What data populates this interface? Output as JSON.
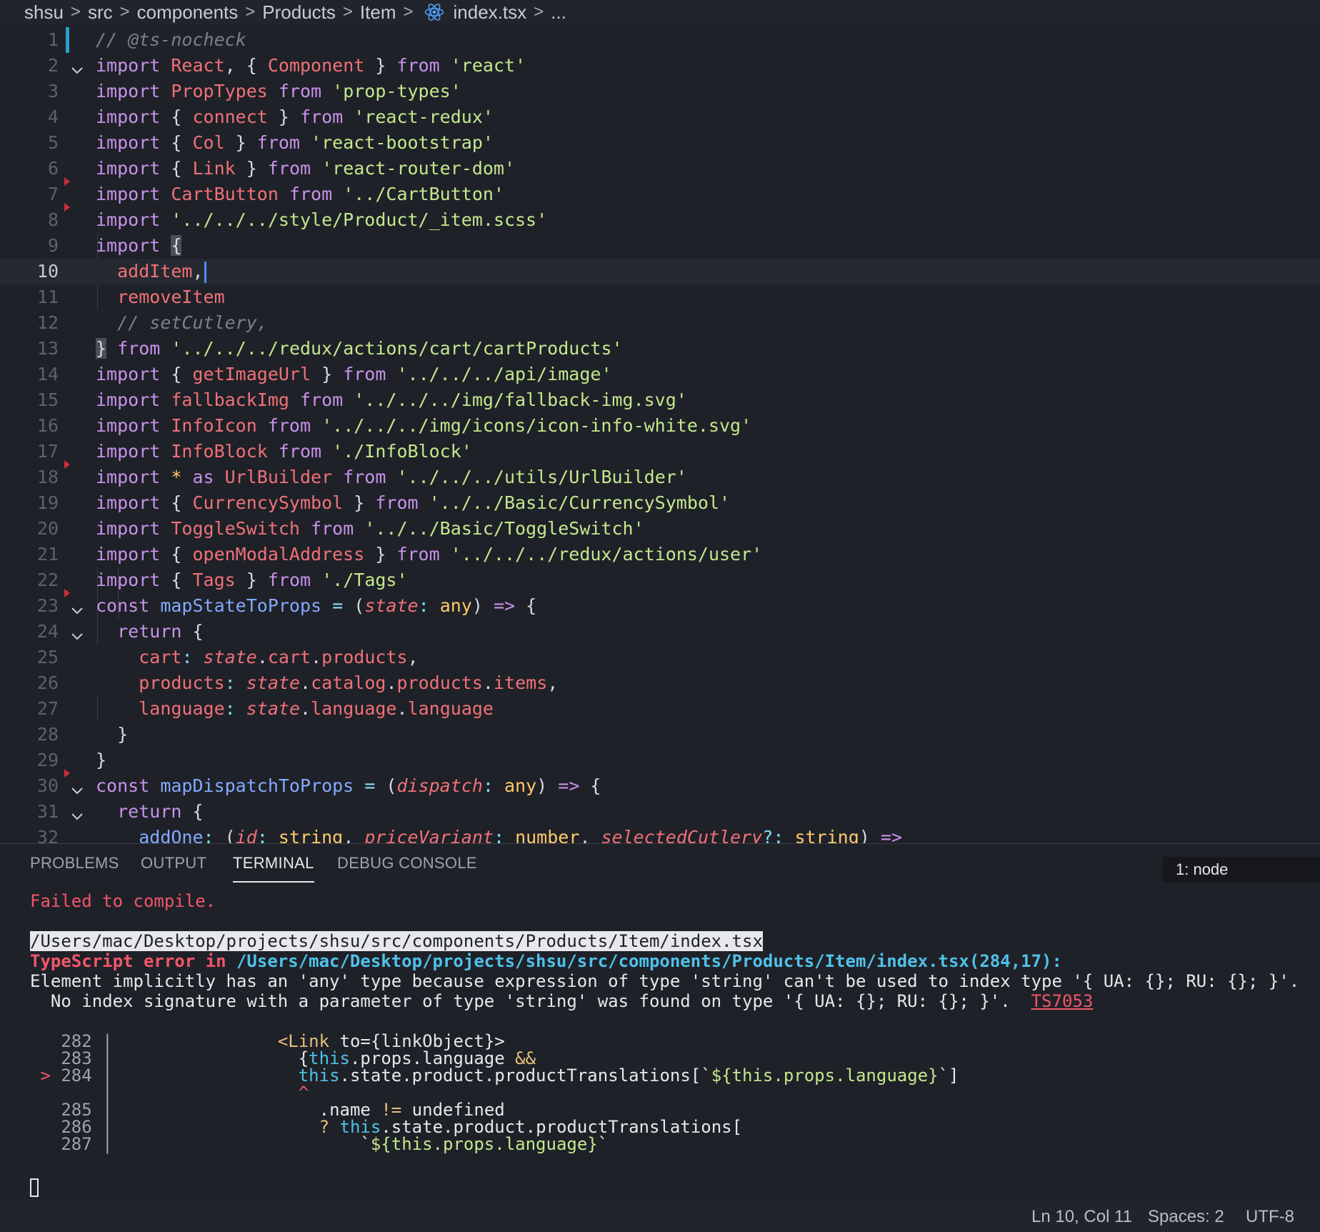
{
  "breadcrumb": {
    "items": [
      "shsu",
      "src",
      "components",
      "Products",
      "Item",
      "index.tsx",
      "..."
    ],
    "file_icon": "react-icon"
  },
  "editor": {
    "current_line": 10,
    "lines": [
      {
        "n": "1",
        "t": [
          [
            "cm",
            "// @ts-nocheck"
          ]
        ]
      },
      {
        "n": "2",
        "fold": true,
        "t": [
          [
            "kw",
            "import "
          ],
          [
            "id",
            "React"
          ],
          [
            "pu",
            ", { "
          ],
          [
            "id",
            "Component"
          ],
          [
            "pu",
            " } "
          ],
          [
            "kw",
            "from "
          ],
          [
            "str",
            "'react'"
          ]
        ]
      },
      {
        "n": "3",
        "t": [
          [
            "kw",
            "import "
          ],
          [
            "id",
            "PropTypes "
          ],
          [
            "kw",
            "from "
          ],
          [
            "str",
            "'prop-types'"
          ]
        ]
      },
      {
        "n": "4",
        "t": [
          [
            "kw",
            "import "
          ],
          [
            "pu",
            "{ "
          ],
          [
            "id",
            "connect"
          ],
          [
            "pu",
            " } "
          ],
          [
            "kw",
            "from "
          ],
          [
            "str",
            "'react-redux'"
          ]
        ]
      },
      {
        "n": "5",
        "t": [
          [
            "kw",
            "import "
          ],
          [
            "pu",
            "{ "
          ],
          [
            "id",
            "Col"
          ],
          [
            "pu",
            " } "
          ],
          [
            "kw",
            "from "
          ],
          [
            "str",
            "'react-bootstrap'"
          ]
        ]
      },
      {
        "n": "6",
        "t": [
          [
            "kw",
            "import "
          ],
          [
            "pu",
            "{ "
          ],
          [
            "id",
            "Link"
          ],
          [
            "pu",
            " } "
          ],
          [
            "kw",
            "from "
          ],
          [
            "str",
            "'react-router-dom'"
          ]
        ]
      },
      {
        "n": "7",
        "t": [
          [
            "kw",
            "import "
          ],
          [
            "id",
            "CartButton "
          ],
          [
            "kw",
            "from "
          ],
          [
            "str",
            "'../CartButton'"
          ]
        ]
      },
      {
        "n": "8",
        "t": [
          [
            "kw",
            "import "
          ],
          [
            "str",
            "'../../../style/Product/_item.scss'"
          ]
        ]
      },
      {
        "n": "9",
        "t": [
          [
            "kw",
            "import "
          ],
          [
            "box",
            "{"
          ]
        ]
      },
      {
        "n": "10",
        "t": [
          [
            "pu",
            "  "
          ],
          [
            "id",
            "addItem"
          ],
          [
            "pu",
            ","
          ],
          [
            "cursor",
            ""
          ]
        ]
      },
      {
        "n": "11",
        "t": [
          [
            "pu",
            "  "
          ],
          [
            "id",
            "removeItem"
          ]
        ]
      },
      {
        "n": "12",
        "t": [
          [
            "pu",
            "  "
          ],
          [
            "cm",
            "// setCutlery,"
          ]
        ]
      },
      {
        "n": "13",
        "t": [
          [
            "box",
            "}"
          ],
          [
            "pu",
            " "
          ],
          [
            "kw",
            "from "
          ],
          [
            "str",
            "'../../../redux/actions/cart/cartProducts'"
          ]
        ]
      },
      {
        "n": "14",
        "t": [
          [
            "kw",
            "import "
          ],
          [
            "pu",
            "{ "
          ],
          [
            "id",
            "getImageUrl"
          ],
          [
            "pu",
            " } "
          ],
          [
            "kw",
            "from "
          ],
          [
            "str",
            "'../../../api/image'"
          ]
        ]
      },
      {
        "n": "15",
        "t": [
          [
            "kw",
            "import "
          ],
          [
            "id",
            "fallbackImg "
          ],
          [
            "kw",
            "from "
          ],
          [
            "str",
            "'../../../img/fallback-img.svg'"
          ]
        ]
      },
      {
        "n": "16",
        "t": [
          [
            "kw",
            "import "
          ],
          [
            "id",
            "InfoIcon "
          ],
          [
            "kw",
            "from "
          ],
          [
            "str",
            "'../../../img/icons/icon-info-white.svg'"
          ]
        ]
      },
      {
        "n": "17",
        "t": [
          [
            "kw",
            "import "
          ],
          [
            "id",
            "InfoBlock "
          ],
          [
            "kw",
            "from "
          ],
          [
            "str",
            "'./InfoBlock'"
          ]
        ]
      },
      {
        "n": "18",
        "t": [
          [
            "kw",
            "import "
          ],
          [
            "ty",
            "* "
          ],
          [
            "kw",
            "as "
          ],
          [
            "id",
            "UrlBuilder "
          ],
          [
            "kw",
            "from "
          ],
          [
            "str",
            "'../../../utils/UrlBuilder'"
          ]
        ]
      },
      {
        "n": "19",
        "t": [
          [
            "kw",
            "import "
          ],
          [
            "pu",
            "{ "
          ],
          [
            "id",
            "CurrencySymbol"
          ],
          [
            "pu",
            " } "
          ],
          [
            "kw",
            "from "
          ],
          [
            "str",
            "'../../Basic/CurrencySymbol'"
          ]
        ]
      },
      {
        "n": "20",
        "t": [
          [
            "kw",
            "import "
          ],
          [
            "id",
            "ToggleSwitch "
          ],
          [
            "kw",
            "from "
          ],
          [
            "str",
            "'../../Basic/ToggleSwitch'"
          ]
        ]
      },
      {
        "n": "21",
        "t": [
          [
            "kw",
            "import "
          ],
          [
            "pu",
            "{ "
          ],
          [
            "id",
            "openModalAddress"
          ],
          [
            "pu",
            " } "
          ],
          [
            "kw",
            "from "
          ],
          [
            "str",
            "'../../../redux/actions/user'"
          ]
        ]
      },
      {
        "n": "22",
        "t": [
          [
            "kw",
            "import "
          ],
          [
            "pu",
            "{ "
          ],
          [
            "id",
            "Tags"
          ],
          [
            "pu",
            " } "
          ],
          [
            "kw",
            "from "
          ],
          [
            "str",
            "'./Tags'"
          ]
        ]
      },
      {
        "n": "23",
        "fold": true,
        "t": [
          [
            "kw",
            "const "
          ],
          [
            "fn",
            "mapStateToProps"
          ],
          [
            "op",
            " = "
          ],
          [
            "pu",
            "("
          ],
          [
            "par",
            "state"
          ],
          [
            "op",
            ": "
          ],
          [
            "ty",
            "any"
          ],
          [
            "pu",
            ") "
          ],
          [
            "kw",
            "=> "
          ],
          [
            "pu",
            "{"
          ]
        ]
      },
      {
        "n": "24",
        "fold": true,
        "t": [
          [
            "pu",
            "  "
          ],
          [
            "kw",
            "return "
          ],
          [
            "pu",
            "{"
          ]
        ]
      },
      {
        "n": "25",
        "t": [
          [
            "pu",
            "    "
          ],
          [
            "id",
            "cart"
          ],
          [
            "op",
            ": "
          ],
          [
            "par",
            "state"
          ],
          [
            "pu",
            "."
          ],
          [
            "id",
            "cart"
          ],
          [
            "pu",
            "."
          ],
          [
            "id",
            "products"
          ],
          [
            "pu",
            ","
          ]
        ]
      },
      {
        "n": "26",
        "t": [
          [
            "pu",
            "    "
          ],
          [
            "id",
            "products"
          ],
          [
            "op",
            ": "
          ],
          [
            "par",
            "state"
          ],
          [
            "pu",
            "."
          ],
          [
            "id",
            "catalog"
          ],
          [
            "pu",
            "."
          ],
          [
            "id",
            "products"
          ],
          [
            "pu",
            "."
          ],
          [
            "id",
            "items"
          ],
          [
            "pu",
            ","
          ]
        ]
      },
      {
        "n": "27",
        "t": [
          [
            "pu",
            "    "
          ],
          [
            "id",
            "language"
          ],
          [
            "op",
            ": "
          ],
          [
            "par",
            "state"
          ],
          [
            "pu",
            "."
          ],
          [
            "id",
            "language"
          ],
          [
            "pu",
            "."
          ],
          [
            "id",
            "language"
          ]
        ]
      },
      {
        "n": "28",
        "t": [
          [
            "pu",
            "  }"
          ]
        ]
      },
      {
        "n": "29",
        "t": [
          [
            "pu",
            "}"
          ]
        ]
      },
      {
        "n": "30",
        "fold": true,
        "t": [
          [
            "kw",
            "const "
          ],
          [
            "fn",
            "mapDispatchToProps"
          ],
          [
            "op",
            " = "
          ],
          [
            "pu",
            "("
          ],
          [
            "par",
            "dispatch"
          ],
          [
            "op",
            ": "
          ],
          [
            "ty",
            "any"
          ],
          [
            "pu",
            ") "
          ],
          [
            "kw",
            "=> "
          ],
          [
            "pu",
            "{"
          ]
        ]
      },
      {
        "n": "31",
        "fold": true,
        "t": [
          [
            "pu",
            "  "
          ],
          [
            "kw",
            "return "
          ],
          [
            "pu",
            "{"
          ]
        ]
      },
      {
        "n": "32",
        "t": [
          [
            "pu",
            "    "
          ],
          [
            "fn",
            "addOne"
          ],
          [
            "op",
            ": "
          ],
          [
            "pu",
            "("
          ],
          [
            "par",
            "id"
          ],
          [
            "op",
            ": "
          ],
          [
            "ty",
            "string"
          ],
          [
            "pu",
            ", "
          ],
          [
            "par",
            "priceVariant"
          ],
          [
            "op",
            ": "
          ],
          [
            "ty",
            "number"
          ],
          [
            "pu",
            ", "
          ],
          [
            "par",
            "selectedCutlery"
          ],
          [
            "op",
            "?: "
          ],
          [
            "ty",
            "string"
          ],
          [
            "pu",
            ") "
          ],
          [
            "kw",
            "=>"
          ]
        ]
      }
    ]
  },
  "panel": {
    "tabs": [
      "PROBLEMS",
      "OUTPUT",
      "TERMINAL",
      "DEBUG CONSOLE"
    ],
    "active_tab": "TERMINAL",
    "terminal_select": "1: node",
    "terminal": {
      "failed": "Failed to compile.",
      "path": "/Users/mac/Desktop/projects/shsu/src/components/Products/Item/index.tsx",
      "error_prefix": "TypeScript error in ",
      "error_path": "/Users/mac/Desktop/projects/shsu/src/components/Products/Item/index.tsx(284,17):",
      "message1": "Element implicitly has an 'any' type because expression of type 'string' can't be used to index type '{ UA: {}; RU: {}; }'.",
      "message2": "  No index signature with a parameter of type 'string' was found on type '{ UA: {}; RU: {}; }'.",
      "error_code": "TS7053",
      "snippet": [
        {
          "marker": "",
          "n": "282",
          "t": [
            [
              "dim",
              " | "
            ],
            [
              "pu",
              "               "
            ],
            [
              "yel",
              "<Link "
            ],
            [
              "pu",
              "to={linkObject}>"
            ]
          ]
        },
        {
          "marker": "",
          "n": "283",
          "t": [
            [
              "dim",
              " | "
            ],
            [
              "pu",
              "                 {"
            ],
            [
              "blu",
              "this"
            ],
            [
              "pu",
              ".props.language "
            ],
            [
              "yel",
              "&&"
            ]
          ]
        },
        {
          "marker": ">",
          "n": "284",
          "t": [
            [
              "dim",
              " | "
            ],
            [
              "pu",
              "                 "
            ],
            [
              "blu",
              "this"
            ],
            [
              "pu",
              ".state.product.productTranslations[`"
            ],
            [
              "grn",
              "${this.props.language}"
            ],
            [
              "pu",
              "`]"
            ]
          ]
        },
        {
          "marker": "",
          "n": "",
          "t": [
            [
              "dim",
              "    | "
            ],
            [
              "pu",
              "                 "
            ],
            [
              "red",
              "^"
            ]
          ]
        },
        {
          "marker": "",
          "n": "285",
          "t": [
            [
              "dim",
              " | "
            ],
            [
              "pu",
              "                   .name "
            ],
            [
              "yel",
              "!="
            ],
            [
              "pu",
              " undefined"
            ]
          ]
        },
        {
          "marker": "",
          "n": "286",
          "t": [
            [
              "dim",
              " | "
            ],
            [
              "pu",
              "                   "
            ],
            [
              "yel",
              "? "
            ],
            [
              "blu",
              "this"
            ],
            [
              "pu",
              ".state.product.productTranslations["
            ]
          ]
        },
        {
          "marker": "",
          "n": "287",
          "t": [
            [
              "dim",
              " | "
            ],
            [
              "pu",
              "                       `"
            ],
            [
              "grn",
              "${this.props.language}"
            ],
            [
              "pu",
              "`"
            ]
          ]
        }
      ]
    }
  },
  "status": {
    "position": "Ln 10, Col 11",
    "spaces": "Spaces: 2",
    "encoding": "UTF-8"
  }
}
